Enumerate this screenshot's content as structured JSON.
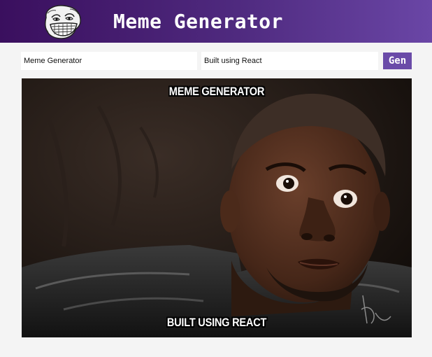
{
  "app": {
    "title": "Meme Generator",
    "logo_icon": "troll-face-icon"
  },
  "form": {
    "top_text_value": "Meme Generator",
    "bottom_text_value": "Built using React",
    "gen_button_label": "Gen"
  },
  "meme": {
    "top_caption": "MEME GENERATOR",
    "bottom_caption": "BUILT USING REACT",
    "image_description_icon": "meme-photo"
  },
  "colors": {
    "header_start": "#3a0f5e",
    "header_end": "#6a46a6",
    "button": "#6a4ba8",
    "page_bg": "#f4f4f4"
  }
}
